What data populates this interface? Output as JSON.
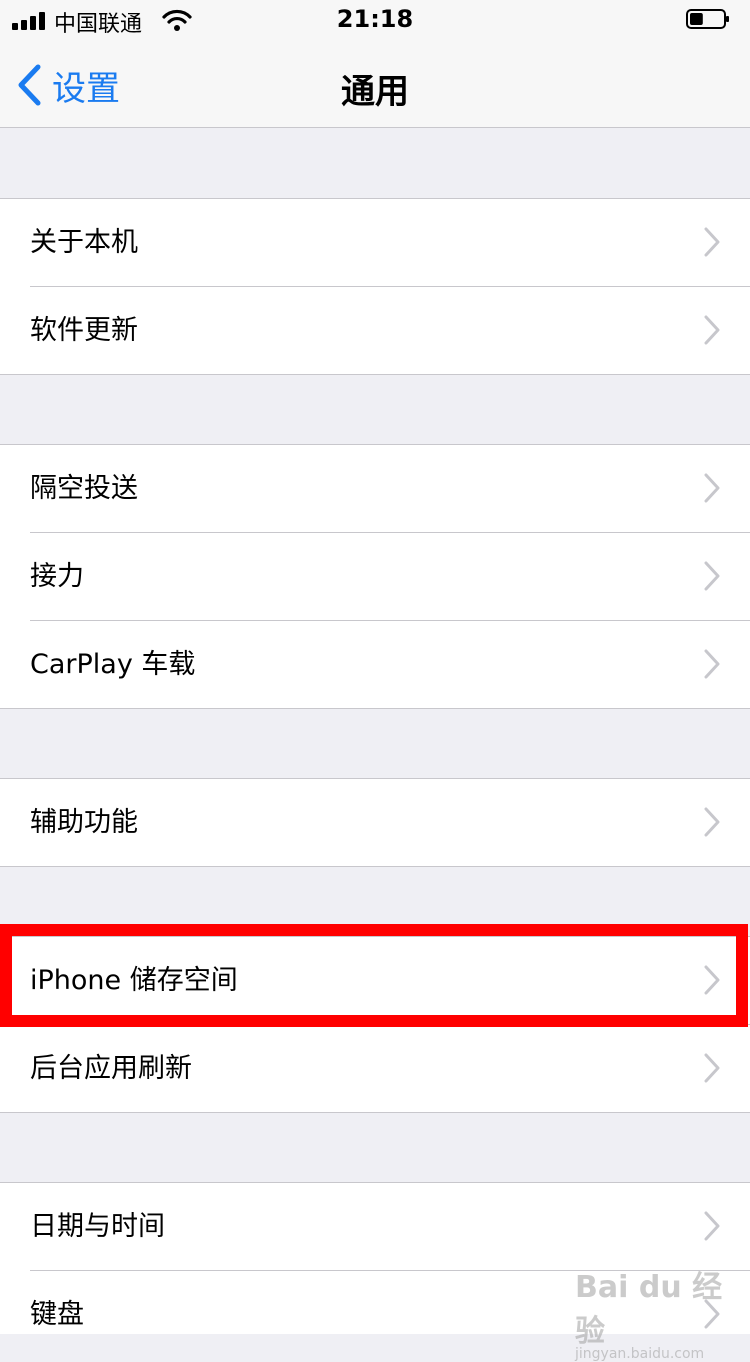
{
  "status_bar": {
    "carrier": "中国联通",
    "time": "21:18"
  },
  "nav": {
    "back_label": "设置",
    "title": "通用"
  },
  "groups": [
    {
      "items": [
        {
          "label": "关于本机"
        },
        {
          "label": "软件更新"
        }
      ]
    },
    {
      "items": [
        {
          "label": "隔空投送"
        },
        {
          "label": "接力"
        },
        {
          "label": "CarPlay 车载"
        }
      ]
    },
    {
      "items": [
        {
          "label": "辅助功能"
        }
      ]
    },
    {
      "items": [
        {
          "label": "iPhone 储存空间"
        },
        {
          "label": "后台应用刷新"
        }
      ]
    },
    {
      "items": [
        {
          "label": "日期与时间"
        },
        {
          "label": "键盘"
        }
      ]
    }
  ],
  "colors": {
    "accent": "#1a7bf0",
    "highlight": "#ff0000",
    "background": "#efeff4"
  },
  "watermark": {
    "brand": "Bai du 经验",
    "sub": "jingyan.baidu.com"
  },
  "battery_level": 0.4
}
